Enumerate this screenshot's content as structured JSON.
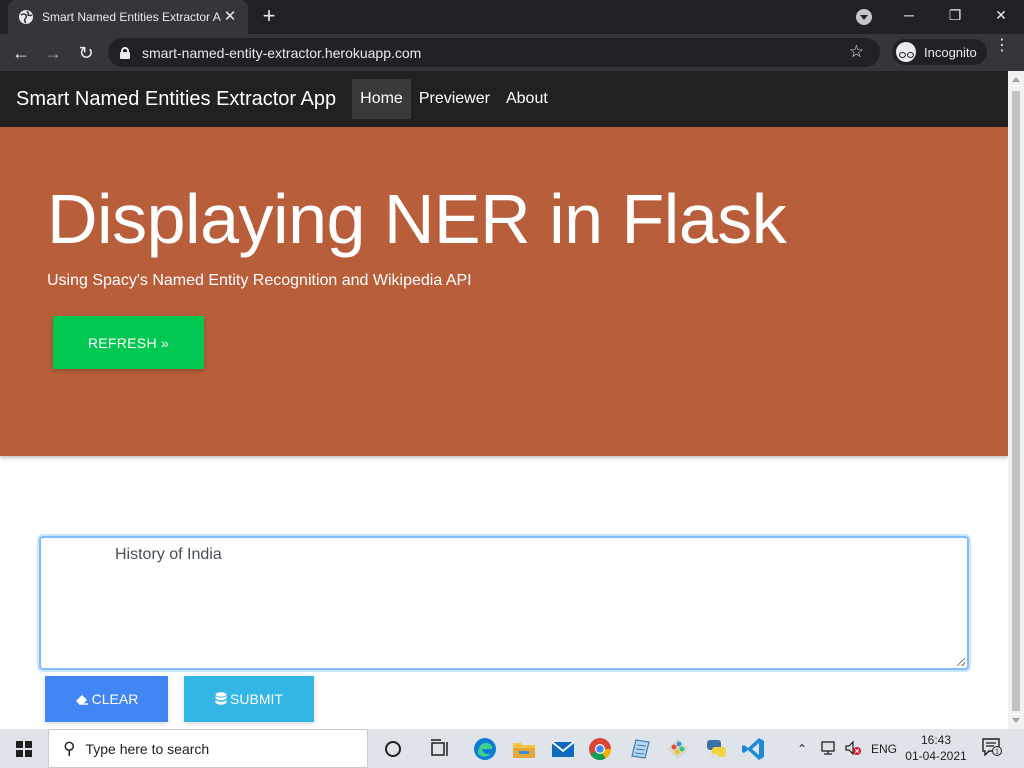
{
  "browser": {
    "tab_title": "Smart Named Entities Extractor A",
    "tab_close": "✕",
    "new_tab": "+",
    "url": "smart-named-entity-extractor.herokuapp.com",
    "incognito_label": "Incognito",
    "window_controls": {
      "minimize": "─",
      "restore": "❐",
      "close": "✕"
    },
    "nav": {
      "back": "←",
      "forward": "→",
      "reload": "↻",
      "star": "☆",
      "menu": "⋮"
    }
  },
  "navbar": {
    "brand": "Smart Named Entities Extractor App",
    "links": [
      {
        "label": "Home",
        "active": true
      },
      {
        "label": "Previewer",
        "active": false
      },
      {
        "label": "About",
        "active": false
      }
    ]
  },
  "hero": {
    "title": "Displaying NER in Flask",
    "subtitle": "Using Spacy's Named Entity Recognition and Wikipedia API",
    "refresh_label": "REFRESH »",
    "background_color": "#b85e3b"
  },
  "form": {
    "textarea_value": "History of India",
    "clear_label": "CLEAR",
    "submit_label": "SUBMIT",
    "clear_color": "#4285f4",
    "submit_color": "#33b5e5",
    "refresh_color": "#00c851"
  },
  "taskbar": {
    "search_placeholder": "Type here to search",
    "language": "ENG",
    "time": "16:43",
    "date": "01-04-2021",
    "notification_count": "1",
    "apps": [
      "task-view",
      "edge",
      "file-explorer",
      "mail",
      "chrome",
      "notepad",
      "paint",
      "python",
      "vscode"
    ]
  }
}
